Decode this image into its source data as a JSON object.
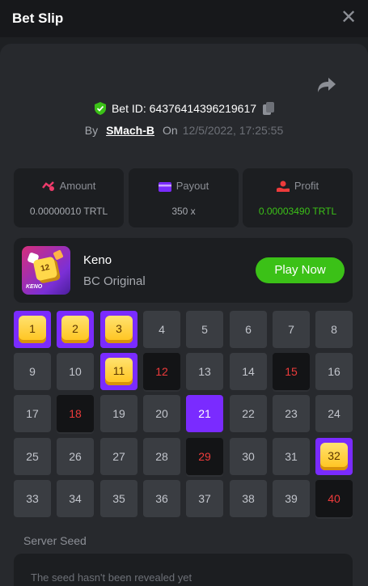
{
  "header": {
    "title": "Bet Slip"
  },
  "bet": {
    "id_text": "Bet ID: 64376414396219617",
    "by_label": "By",
    "user": "SMach-B",
    "on_label": "On",
    "date": "12/5/2022, 17:25:55"
  },
  "stats": {
    "amount": {
      "label": "Amount",
      "value": "0.00000010 TRTL"
    },
    "payout": {
      "label": "Payout",
      "value": "350 x"
    },
    "profit": {
      "label": "Profit",
      "value": "0.00003490 TRTL"
    }
  },
  "game": {
    "name": "Keno",
    "subtitle": "BC Original",
    "thumb_number": "12",
    "thumb_logo": "KENO",
    "play_label": "Play Now"
  },
  "grid": {
    "numbers": [
      "1",
      "2",
      "3",
      "4",
      "5",
      "6",
      "7",
      "8",
      "9",
      "10",
      "11",
      "12",
      "13",
      "14",
      "15",
      "16",
      "17",
      "18",
      "19",
      "20",
      "21",
      "22",
      "23",
      "24",
      "25",
      "26",
      "27",
      "28",
      "29",
      "30",
      "31",
      "32",
      "33",
      "34",
      "35",
      "36",
      "37",
      "38",
      "39",
      "40"
    ],
    "hits": [
      1,
      2,
      3,
      11,
      32
    ],
    "picked": [
      21
    ],
    "misses": [
      12,
      15,
      18,
      29,
      40
    ]
  },
  "seed": {
    "label": "Server Seed",
    "value": "The seed hasn't been revealed yet"
  },
  "colors": {
    "accent_purple": "#7a2bff",
    "green": "#3bc117",
    "miss_red": "#ed3b3b",
    "gem_yellow": "#ffc21a"
  },
  "icons": [
    "close-icon",
    "share-icon",
    "shield-check-icon",
    "copy-icon",
    "amount-icon",
    "payout-icon",
    "profit-icon"
  ]
}
